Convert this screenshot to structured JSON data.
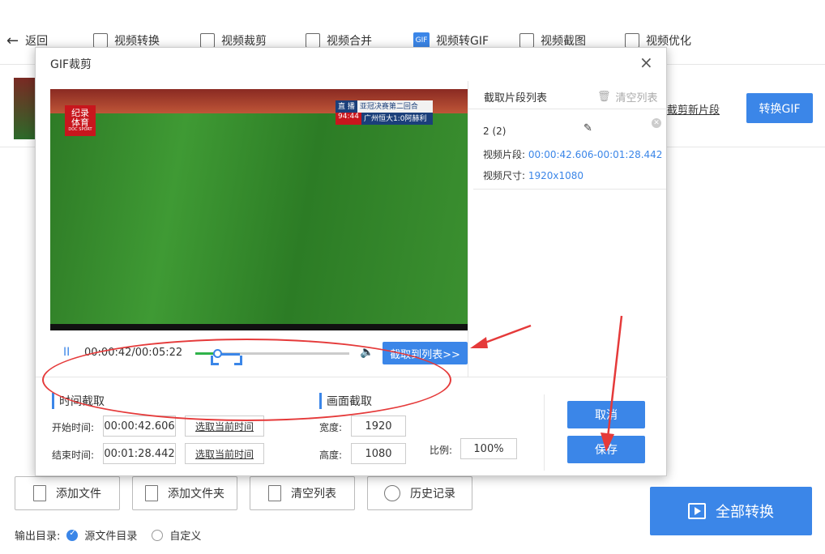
{
  "nav": {
    "back": "返回",
    "items": [
      "视频转换",
      "视频裁剪",
      "视频合并",
      "视频转GIF",
      "视频截图",
      "视频优化"
    ],
    "gif_icon_text": "GIF"
  },
  "main": {
    "new_segment": "截剪新片段",
    "convert_gif": "转换GIF"
  },
  "bottom": {
    "add_file": "添加文件",
    "add_folder": "添加文件夹",
    "clear_list": "清空列表",
    "history": "历史记录",
    "convert_all": "全部转换",
    "output_label": "输出目录:",
    "option_source": "源文件目录",
    "option_custom": "自定义"
  },
  "dialog": {
    "title": "GIF裁剪",
    "close": "×",
    "video": {
      "logo_line1": "纪录",
      "logo_line2": "体育",
      "logo_line3": "DOC SPORT",
      "live": "直 播",
      "match": "亚冠决赛第二回合",
      "clock": "94:44",
      "score": "广州恒大1:0阿赫利"
    },
    "player": {
      "play_state": "II",
      "time": "00:00:42/00:05:22",
      "progress": 0.13,
      "volume_icon": "speaker-icon",
      "cut_button": "截取到列表>>"
    },
    "segments": {
      "title": "截取片段列表",
      "clear": "清空列表",
      "items": [
        {
          "name": "2 (2)",
          "segment_label": "视频片段:",
          "segment_value": "00:00:42.606-00:01:28.442",
          "size_label": "视频尺寸:",
          "size_value": "1920x1080"
        }
      ]
    },
    "time_cut": {
      "heading": "时间截取",
      "start_label": "开始时间:",
      "start_value": "00:00:42.606",
      "end_label": "结束时间:",
      "end_value": "00:01:28.442",
      "pick_current": "选取当前时间"
    },
    "frame_cut": {
      "heading": "画面截取",
      "width_label": "宽度:",
      "width_value": "1920",
      "height_label": "高度:",
      "height_value": "1080",
      "ratio_label": "比例:",
      "ratio_value": "100%"
    },
    "cancel": "取消",
    "save": "保存"
  },
  "colors": {
    "accent": "#3b86e8",
    "annotation": "#e53a3a"
  }
}
